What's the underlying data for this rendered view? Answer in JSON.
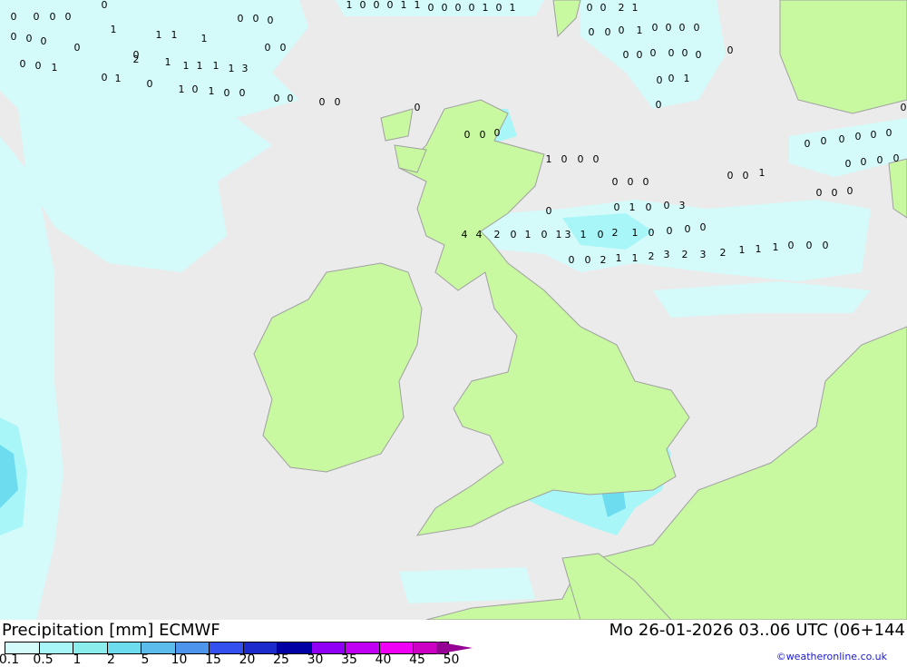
{
  "header": {
    "title": "Precipitation [mm] ECMWF",
    "datetime": "Mo 26-01-2026 03..06 UTC (06+144",
    "credit": "©weatheronline.co.uk"
  },
  "legend": {
    "ticks": [
      "0.1",
      "0.5",
      "1",
      "2",
      "5",
      "10",
      "15",
      "20",
      "25",
      "30",
      "35",
      "40",
      "45",
      "50"
    ],
    "colors": [
      "#d4fafa",
      "#a8f6f8",
      "#8ceeec",
      "#6cdcee",
      "#5cbcec",
      "#4c94ec",
      "#3450ee",
      "#1c2ccc",
      "#0000a4",
      "#9000f4",
      "#c000f4",
      "#f000f4",
      "#cc00c4",
      "#940094"
    ]
  },
  "colors": {
    "land": "#c8f8a0",
    "sea": "#ebebeb",
    "precip_light": "#d4fafa",
    "precip_mid": "#a8f6f8",
    "precip_1": "#8ceeec",
    "precip_2": "#6cdcee",
    "border": "#a0a0a0"
  },
  "map_labels": [
    "0",
    "0",
    "0",
    "0",
    "0",
    "1",
    "0",
    "0",
    "0",
    "0",
    "0",
    "1",
    "1",
    "1",
    "0",
    "0",
    "0",
    "0",
    "0",
    "1",
    "0",
    "0",
    "0",
    "1",
    "1",
    "0",
    "0",
    "0",
    "0",
    "1",
    "0",
    "1",
    "0",
    "0",
    "2",
    "1",
    "0",
    "0",
    "0",
    "1",
    "0",
    "0",
    "0",
    "0",
    "0",
    "0",
    "0",
    "0",
    "0",
    "0",
    "0",
    "0",
    "0",
    "1",
    "0",
    "0",
    "0",
    "1",
    "0",
    "1",
    "2",
    "1",
    "1",
    "1",
    "1",
    "1",
    "3",
    "0",
    "1",
    "0",
    "1",
    "0",
    "0",
    "0",
    "0",
    "0",
    "0",
    "0",
    "0",
    "0",
    "0",
    "1",
    "0",
    "0",
    "0",
    "0",
    "0",
    "0",
    "0",
    "0",
    "1",
    "0",
    "0",
    "0",
    "0",
    "0",
    "0",
    "0",
    "0",
    "0",
    "0",
    "0",
    "0",
    "0",
    "0",
    "0",
    "0",
    "1",
    "0",
    "0",
    "3",
    "4",
    "4",
    "2",
    "0",
    "1",
    "0",
    "1",
    "3",
    "1",
    "0",
    "2",
    "1",
    "0",
    "0",
    "0",
    "0",
    "0",
    "0",
    "2",
    "1",
    "1",
    "2",
    "3",
    "2",
    "3",
    "2",
    "1",
    "1",
    "1",
    "0",
    "0",
    "0"
  ]
}
